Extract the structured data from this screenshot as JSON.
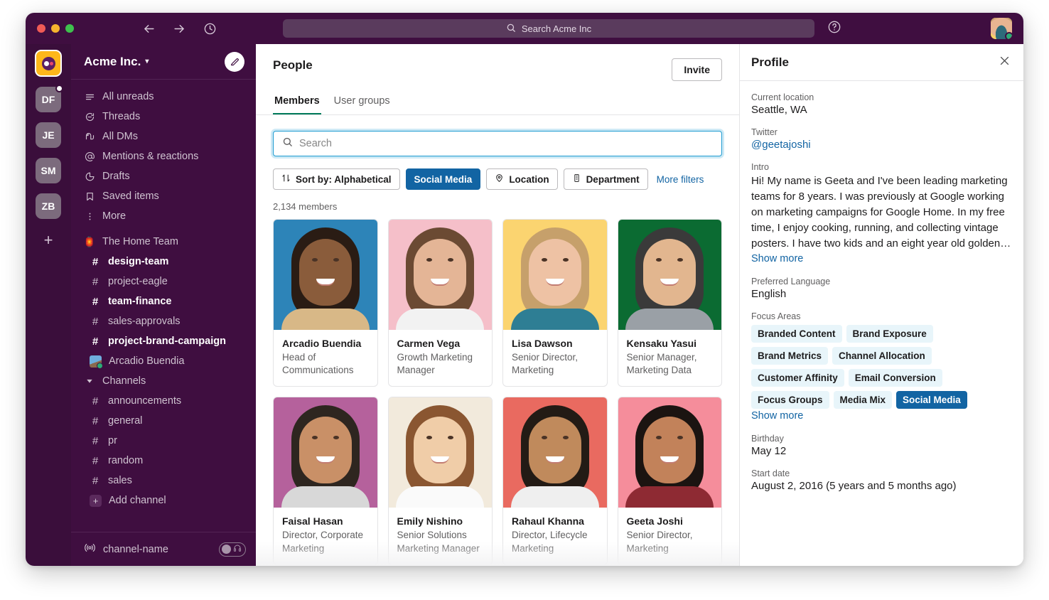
{
  "titlebar": {
    "back_icon": "arrow-left-icon",
    "forward_icon": "arrow-right-icon",
    "history_icon": "clock-icon",
    "search_placeholder": "Search Acme Inc",
    "help_icon": "question-circle-icon"
  },
  "rail": {
    "workspace_logo": "acme-logo",
    "tiles": [
      {
        "initials": "DF",
        "unread": true
      },
      {
        "initials": "JE",
        "unread": false
      },
      {
        "initials": "SM",
        "unread": false
      },
      {
        "initials": "ZB",
        "unread": false
      }
    ],
    "add_label": "+"
  },
  "sidebar": {
    "workspace_name": "Acme Inc.",
    "compose_icon": "compose-icon",
    "nav": [
      {
        "label": "All unreads",
        "icon": "unreads-icon"
      },
      {
        "label": "Threads",
        "icon": "threads-icon"
      },
      {
        "label": "All DMs",
        "icon": "dms-icon"
      },
      {
        "label": "Mentions & reactions",
        "icon": "at-icon"
      },
      {
        "label": "Drafts",
        "icon": "drafts-icon"
      },
      {
        "label": "Saved items",
        "icon": "bookmark-icon"
      },
      {
        "label": "More",
        "icon": "more-vertical-icon"
      }
    ],
    "home_team": {
      "label": "The Home Team",
      "emoji": "🏮"
    },
    "home_channels": [
      {
        "label": "design-team",
        "bold": true
      },
      {
        "label": "project-eagle",
        "bold": false
      },
      {
        "label": "team-finance",
        "bold": true
      },
      {
        "label": "sales-approvals",
        "bold": false
      },
      {
        "label": "project-brand-campaign",
        "bold": true
      }
    ],
    "dm": {
      "label": "Arcadio Buendia"
    },
    "channels_header": "Channels",
    "channels": [
      {
        "label": "announcements"
      },
      {
        "label": "general"
      },
      {
        "label": "pr"
      },
      {
        "label": "random"
      },
      {
        "label": "sales"
      }
    ],
    "add_channel": "Add channel",
    "footer": {
      "label": "channel-name",
      "icon": "huddle-icon",
      "toggle_icon": "headphones-icon"
    }
  },
  "main": {
    "title": "People",
    "invite_label": "Invite",
    "tabs": [
      {
        "label": "Members",
        "active": true
      },
      {
        "label": "User groups",
        "active": false
      }
    ],
    "search": {
      "placeholder": "Search",
      "value": "",
      "icon": "search-icon"
    },
    "filters": [
      {
        "label": "Sort by: Alphabetical",
        "icon": "sort-icon",
        "selected": false
      },
      {
        "label": "Social Media",
        "icon": "",
        "selected": true
      },
      {
        "label": "Location",
        "icon": "pin-icon",
        "selected": false
      },
      {
        "label": "Department",
        "icon": "building-icon",
        "selected": false
      }
    ],
    "more_filters": "More filters",
    "member_count": "2,134 members",
    "members": [
      {
        "name": "Arcadio Buendia",
        "title": "Head of Communications",
        "bg": "#2D84B8",
        "hair": "#2A1C14",
        "skin": "#8A5C3B",
        "body": "#D8B887"
      },
      {
        "name": "Carmen Vega",
        "title": "Growth Marketing Manager",
        "bg": "#F5BFC9",
        "hair": "#6B4A33",
        "skin": "#E4B596",
        "body": "#F2F2F2"
      },
      {
        "name": "Lisa Dawson",
        "title": "Senior Director, Marketing",
        "bg": "#FBD470",
        "hair": "#C6A06B",
        "skin": "#EEC2A4",
        "body": "#2E7E94"
      },
      {
        "name": "Kensaku Yasui",
        "title": "Senior Manager, Marketing Data",
        "bg": "#0B6B32",
        "hair": "#3A3A3A",
        "skin": "#E2B68F",
        "body": "#9AA0A6"
      },
      {
        "name": "Faisal Hasan",
        "title": "Director, Corporate Marketing",
        "bg": "#B5619C",
        "hair": "#2E2620",
        "skin": "#C99067",
        "body": "#D8D8D8"
      },
      {
        "name": "Emily Nishino",
        "title": "Senior Solutions Marketing Manager",
        "bg": "#F2EADC",
        "hair": "#8A5631",
        "skin": "#F0CDA8",
        "body": "#FAFAFA"
      },
      {
        "name": "Rahaul Khanna",
        "title": "Director, Lifecycle Marketing",
        "bg": "#E96A60",
        "hair": "#231B15",
        "skin": "#C08A5C",
        "body": "#EFEFEF"
      },
      {
        "name": "Geeta Joshi",
        "title": "Senior Director, Marketing",
        "bg": "#F58D9B",
        "hair": "#1B1411",
        "skin": "#C2825A",
        "body": "#8E2A33"
      }
    ]
  },
  "profile": {
    "title": "Profile",
    "close_icon": "close-icon",
    "current_location_label": "Current location",
    "current_location": "Seattle, WA",
    "twitter_label": "Twitter",
    "twitter_handle": "@geetajoshi",
    "intro_label": "Intro",
    "intro": "Hi! My name is Geeta and I've been leading marketing teams for 8 years. I was previously at Google working on marketing campaigns for Google Home. In my free time, I enjoy cooking, running, and collecting vintage posters. I have two kids and an eight year old golden…",
    "intro_show_more": "Show more",
    "language_label": "Preferred Language",
    "language": "English",
    "focus_label": "Focus Areas",
    "focus_areas": [
      {
        "label": "Branded Content",
        "selected": false
      },
      {
        "label": "Brand Exposure",
        "selected": false
      },
      {
        "label": "Brand Metrics",
        "selected": false
      },
      {
        "label": "Channel Allocation",
        "selected": false
      },
      {
        "label": "Customer Affinity",
        "selected": false
      },
      {
        "label": "Email Conversion",
        "selected": false
      },
      {
        "label": "Focus Groups",
        "selected": false
      },
      {
        "label": "Media Mix",
        "selected": false
      },
      {
        "label": "Social Media",
        "selected": true
      }
    ],
    "focus_show_more": "Show more",
    "birthday_label": "Birthday",
    "birthday": "May 12",
    "start_date_label": "Start date",
    "start_date": "August 2, 2016 (5 years and 5 months ago)"
  },
  "colors": {
    "sidebar_purple": "#3F0E40",
    "rail_purple": "#3A0E3B",
    "accent_blue": "#1264A3",
    "tab_green": "#007A5A"
  }
}
